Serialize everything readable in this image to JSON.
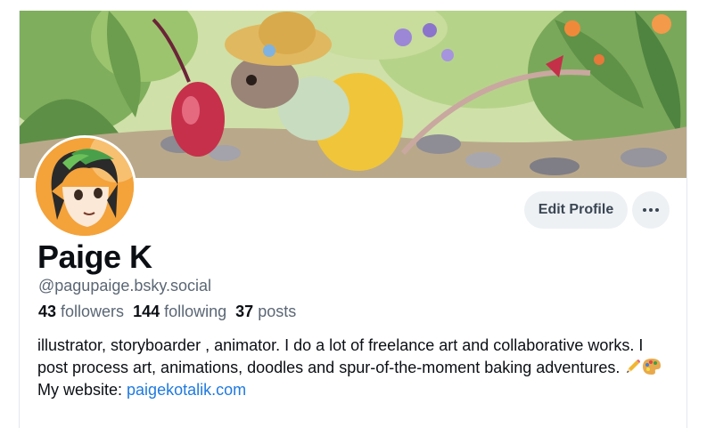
{
  "profile": {
    "display_name": "Paige K",
    "handle": "@pagupaige.bsky.social",
    "edit_label": "Edit Profile",
    "stats": {
      "followers_count": "43",
      "followers_label": "followers",
      "following_count": "144",
      "following_label": "following",
      "posts_count": "37",
      "posts_label": "posts"
    },
    "bio": {
      "line1": " illustrator, storyboarder , animator. I do a lot of freelance art and collaborative works. I post process art, animations, doodles and spur-of-the-moment baking adventures. ",
      "emoji_1": "pencil-icon",
      "emoji_2": "palette-icon",
      "website_prefix": " My website: ",
      "website_link": "paigekotalik.com"
    }
  },
  "banner": {
    "icon": "mouse-in-garden-illustration"
  },
  "avatar": {
    "icon": "green-haired-character-avatar"
  },
  "colors": {
    "link": "#1f7ae0",
    "muted_text": "#5b6775",
    "button_bg": "#eef1f4"
  }
}
